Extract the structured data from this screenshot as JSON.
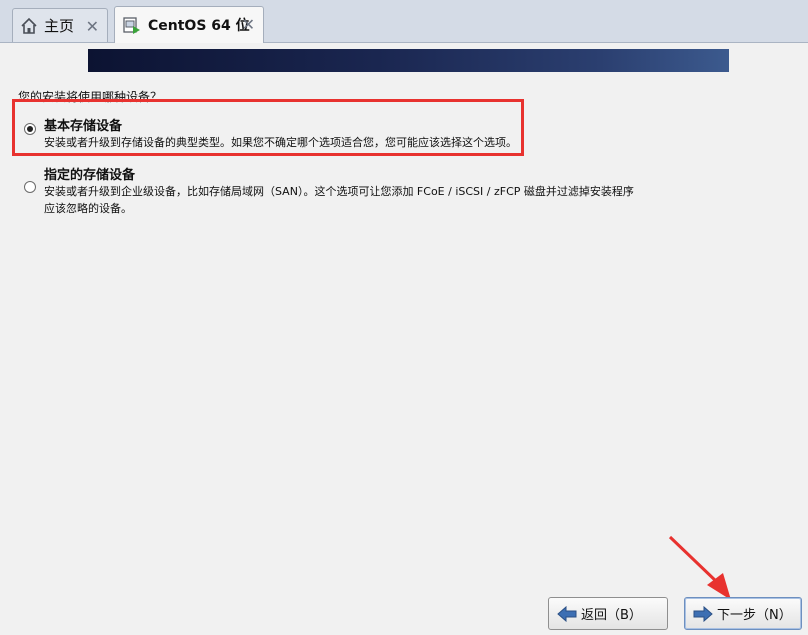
{
  "tabs": [
    {
      "label": "主页",
      "icon": "home-icon",
      "close": "✕"
    },
    {
      "label": "CentOS 64 位",
      "icon": "vm-icon",
      "close": "✕"
    }
  ],
  "installer": {
    "question": "您的安装将使用哪种设备？",
    "options": [
      {
        "title": "基本存储设备",
        "desc": [
          "安装或者升级到存储设备的典型类型。如果您不确定哪个选项适合您，您可能应该选择这个选项。"
        ],
        "selected": true
      },
      {
        "title": "指定的存储设备",
        "desc": [
          "安装或者升级到企业级设备，比如存储局域网（SAN）。这个选项可让您添加 FCoE / iSCSI / zFCP 磁盘并过滤掉安装程序",
          "应该忽略的设备。"
        ],
        "selected": false
      }
    ]
  },
  "buttons": {
    "back": "返回（B）",
    "next": "下一步（N）"
  },
  "colors": {
    "highlight": "#e8322f",
    "banner": "#1a2650",
    "annotation_arrow": "#e8322f"
  }
}
